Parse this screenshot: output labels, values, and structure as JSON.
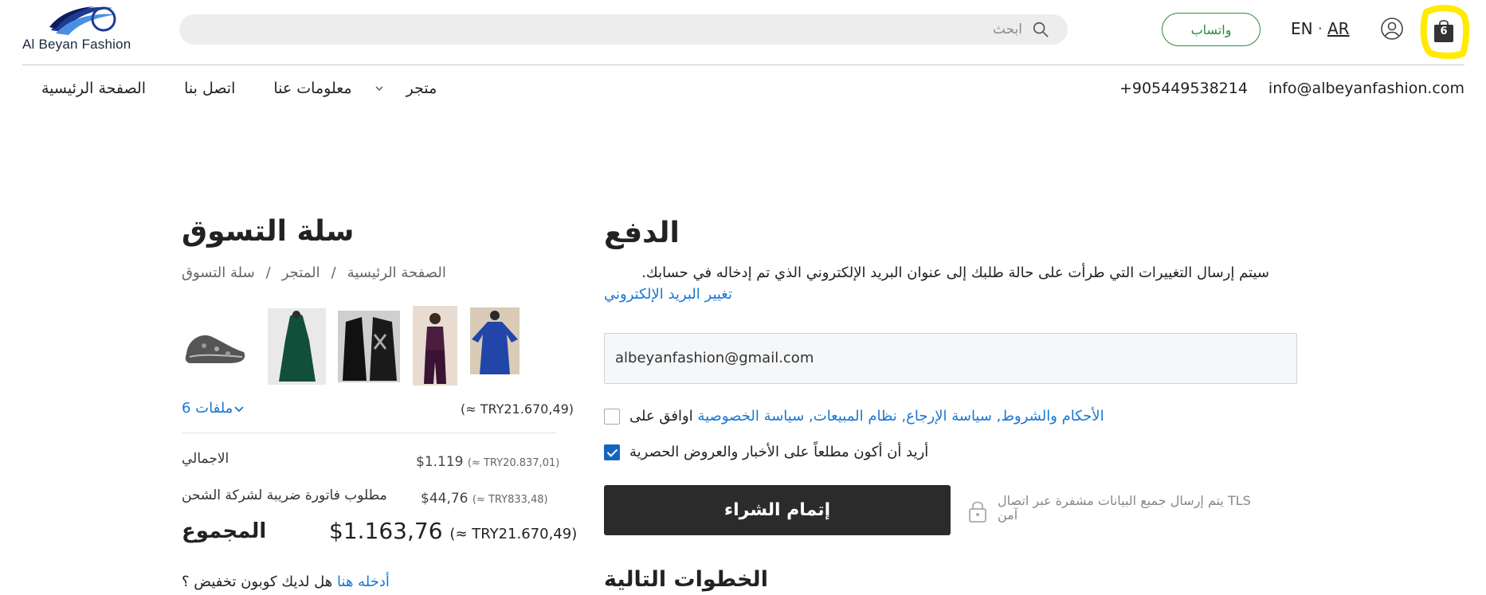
{
  "header": {
    "logo_text": "Al Beyan Fashion",
    "search_placeholder": "ابحث",
    "whatsapp_label": "واتساب",
    "lang_en": "EN",
    "lang_sep": "·",
    "lang_ar": "AR",
    "cart_count": "6",
    "highlight_color": "#ffea00"
  },
  "nav": {
    "items": [
      "الصفحة الرئيسية",
      "اتصل بنا",
      "معلومات عنا",
      "متجر"
    ]
  },
  "contact": {
    "phone": "+905449538214",
    "email": "info@albeyanfashion.com"
  },
  "cart": {
    "title": "سلة التسوق",
    "breadcrumb": [
      "الصفحة الرئيسية",
      "/",
      "المتجر",
      "/",
      "سلة التسوق"
    ],
    "files_label": "ملفات 6",
    "subtotal_try": "(≈ TRY21.670,49)",
    "rows": [
      {
        "label": "الاجمالي",
        "usd": "$1.119",
        "try": "(≈ TRY20.837,01)"
      },
      {
        "label": "مطلوب فاتورة ضريبة لشركة الشحن",
        "usd": "$44,76",
        "try": "(≈ TRY833,48)"
      }
    ],
    "total_label": "المجموع",
    "total_usd": "$1.163,76",
    "total_try": "(≈ TRY21.670,49)",
    "coupon_question": "هل لديك كوبون تخفيض ؟",
    "coupon_link": "أدخله هنا"
  },
  "payment": {
    "title": "الدفع",
    "description": "سيتم إرسال التغييرات التي طرأت على حالة طلبك إلى عنوان البريد الإلكتروني الذي تم إدخاله في حسابك.",
    "change_email": "تغيير البريد الإلكتروني",
    "email_value": "albeyanfashion@gmail.com",
    "agree_prefix": "اوافق على",
    "agree_links": "الأحكام والشروط, سياسة الإرجاع, نظام المبيعات, سياسة الخصوصية",
    "agree_checked": false,
    "news_label": "أريد أن أكون مطلعاً على الأخبار والعروض الحصرية",
    "news_checked": true,
    "buy_label": "إتمام الشراء",
    "secure_text": "TLS يتم إرسال جميع البيانات مشفرة عبر اتصال آمن",
    "next_steps": "الخطوات التالية"
  }
}
